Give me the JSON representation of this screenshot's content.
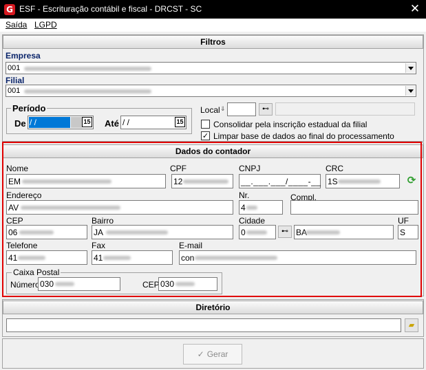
{
  "window": {
    "title": "ESF - Escrituração contábil e fiscal - DRCST - SC",
    "icon": "G",
    "close": "✕"
  },
  "menu": {
    "saida": "Saída",
    "lgpd": "LGPD"
  },
  "filtros": {
    "header": "Filtros",
    "empresa_label": "Empresa",
    "empresa_value": "001",
    "filial_label": "Filial",
    "filial_value": "001",
    "periodo_label": "Período",
    "de_label": "De",
    "de_value": " / /",
    "ate_label": "Até",
    "ate_value": " / /",
    "calendar_glyph": "15",
    "local_label": "Local",
    "consolidar_label": "Consolidar pela inscrição estadual da filial",
    "consolidar_checked": false,
    "limpar_label": "Limpar base de dados ao final do processamento",
    "limpar_checked": true
  },
  "contador": {
    "header": "Dados do contador",
    "nome_label": "Nome",
    "nome_value": "EM",
    "cpf_label": "CPF",
    "cpf_value": "12",
    "cnpj_label": "CNPJ",
    "cnpj_value": "__.___.___/____-__",
    "crc_label": "CRC",
    "crc_value": "1S",
    "endereco_label": "Endereço",
    "endereco_value": "AV",
    "nr_label": "Nr.",
    "nr_value": "4",
    "compl_label": "Compl.",
    "compl_value": "",
    "cep_label": "CEP",
    "cep_value": "06",
    "bairro_label": "Bairro",
    "bairro_value": "JA",
    "cidade_label": "Cidade",
    "cidade_code": "0",
    "cidade_name": "BA",
    "uf_label": "UF",
    "uf_value": "S",
    "telefone_label": "Telefone",
    "telefone_value": "41",
    "fax_label": "Fax",
    "fax_value": "41",
    "email_label": "E-mail",
    "email_value": "con",
    "caixa_postal_label": "Caixa Postal",
    "numero_label": "Número",
    "numero_value": "030",
    "cep2_label": "CEP",
    "cep2_value": "030"
  },
  "diretorio": {
    "header": "Diretório",
    "value": ""
  },
  "actions": {
    "gerar_label": "Gerar",
    "gerar_icon": "✓"
  }
}
